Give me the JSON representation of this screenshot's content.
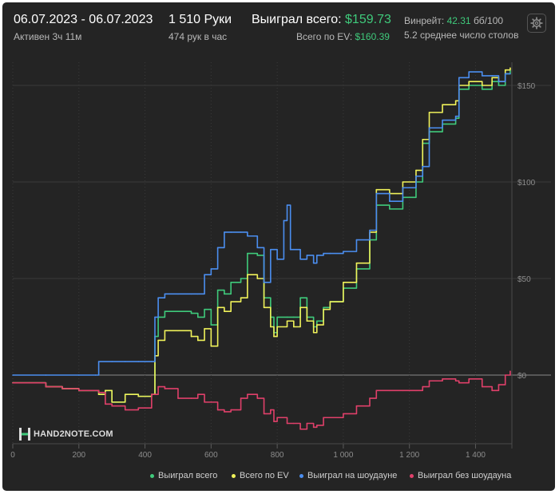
{
  "header": {
    "date_range": "06.07.2023 - 06.07.2023",
    "active_time": "Активен 3ч 11м",
    "hands": "1 510 Руки",
    "hands_per_hour": "474 рук в час",
    "won_total_label": "Выиграл всего:",
    "won_total_value": "$159.73",
    "ev_total_label": "Всего по EV:",
    "ev_total_value": "$160.39",
    "winrate_label": "Винрейт:",
    "winrate_value": "42.31",
    "winrate_unit": "бб/100",
    "avg_tables": "5.2 среднее число столов"
  },
  "logo": {
    "text": "HAND2NOTE.COM"
  },
  "icons": {
    "settings": "gear-icon",
    "logo": "h2n-logo-icon"
  },
  "colors": {
    "background": "#242424",
    "won_total": "#3fca7b",
    "ev_total": "#f0f25a",
    "showdown": "#4b8ef0",
    "non_showdown": "#e0406a",
    "grid": "#3a3a3a",
    "zero_line": "#8a8a8a"
  },
  "chart_data": {
    "type": "line",
    "xlim": [
      0,
      1510
    ],
    "ylim": [
      -30,
      160
    ],
    "x_ticks": [
      0,
      200,
      400,
      600,
      800,
      1000,
      1200,
      1400
    ],
    "x_tick_labels": [
      "0",
      "200",
      "400",
      "600",
      "800",
      "1 000",
      "1 200",
      "1 400"
    ],
    "y_ticks": [
      150,
      100,
      50,
      0
    ],
    "y_tick_labels": [
      "$150",
      "$100",
      "$50",
      "$0"
    ],
    "grid": true,
    "legend_position": "bottom-right",
    "series": [
      {
        "name": "Выиграл всего",
        "color": "#3fca7b",
        "points": [
          [
            0,
            -4
          ],
          [
            50,
            -4
          ],
          [
            100,
            -6
          ],
          [
            150,
            -7
          ],
          [
            200,
            -8
          ],
          [
            260,
            -10
          ],
          [
            280,
            -8
          ],
          [
            300,
            -14
          ],
          [
            340,
            -10
          ],
          [
            380,
            -11
          ],
          [
            420,
            -10
          ],
          [
            430,
            20
          ],
          [
            440,
            30
          ],
          [
            460,
            33
          ],
          [
            500,
            33
          ],
          [
            540,
            32
          ],
          [
            560,
            30
          ],
          [
            580,
            34
          ],
          [
            600,
            26
          ],
          [
            620,
            44
          ],
          [
            640,
            42
          ],
          [
            660,
            48
          ],
          [
            690,
            50
          ],
          [
            710,
            63
          ],
          [
            740,
            62
          ],
          [
            760,
            40
          ],
          [
            780,
            30
          ],
          [
            790,
            22
          ],
          [
            800,
            30
          ],
          [
            830,
            30
          ],
          [
            850,
            30
          ],
          [
            870,
            40
          ],
          [
            890,
            30
          ],
          [
            910,
            25
          ],
          [
            920,
            28
          ],
          [
            940,
            35
          ],
          [
            960,
            38
          ],
          [
            1000,
            45
          ],
          [
            1040,
            55
          ],
          [
            1080,
            70
          ],
          [
            1100,
            88
          ],
          [
            1140,
            86
          ],
          [
            1180,
            92
          ],
          [
            1220,
            100
          ],
          [
            1240,
            120
          ],
          [
            1260,
            126
          ],
          [
            1300,
            130
          ],
          [
            1340,
            133
          ],
          [
            1350,
            148
          ],
          [
            1380,
            150
          ],
          [
            1420,
            148
          ],
          [
            1450,
            152
          ],
          [
            1470,
            150
          ],
          [
            1490,
            156
          ],
          [
            1505,
            158
          ]
        ]
      },
      {
        "name": "Всего по EV",
        "color": "#f0f25a",
        "points": [
          [
            0,
            -4
          ],
          [
            50,
            -4
          ],
          [
            100,
            -6
          ],
          [
            150,
            -7
          ],
          [
            200,
            -8
          ],
          [
            260,
            -10
          ],
          [
            280,
            -8
          ],
          [
            300,
            -14
          ],
          [
            340,
            -10
          ],
          [
            380,
            -11
          ],
          [
            420,
            -10
          ],
          [
            430,
            10
          ],
          [
            440,
            18
          ],
          [
            460,
            23
          ],
          [
            500,
            23
          ],
          [
            540,
            20
          ],
          [
            560,
            18
          ],
          [
            580,
            24
          ],
          [
            600,
            15
          ],
          [
            620,
            35
          ],
          [
            640,
            33
          ],
          [
            660,
            38
          ],
          [
            690,
            40
          ],
          [
            710,
            52
          ],
          [
            740,
            50
          ],
          [
            760,
            35
          ],
          [
            780,
            25
          ],
          [
            790,
            20
          ],
          [
            800,
            25
          ],
          [
            830,
            28
          ],
          [
            850,
            25
          ],
          [
            870,
            35
          ],
          [
            890,
            28
          ],
          [
            910,
            22
          ],
          [
            920,
            26
          ],
          [
            940,
            34
          ],
          [
            960,
            38
          ],
          [
            1000,
            48
          ],
          [
            1040,
            58
          ],
          [
            1080,
            74
          ],
          [
            1100,
            96
          ],
          [
            1140,
            94
          ],
          [
            1180,
            100
          ],
          [
            1220,
            106
          ],
          [
            1240,
            122
          ],
          [
            1260,
            136
          ],
          [
            1300,
            140
          ],
          [
            1340,
            142
          ],
          [
            1350,
            150
          ],
          [
            1380,
            152
          ],
          [
            1420,
            150
          ],
          [
            1450,
            154
          ],
          [
            1470,
            152
          ],
          [
            1490,
            158
          ],
          [
            1505,
            159
          ]
        ]
      },
      {
        "name": "Выиграл на шоудауне",
        "color": "#4b8ef0",
        "points": [
          [
            0,
            0
          ],
          [
            100,
            0
          ],
          [
            200,
            0
          ],
          [
            250,
            0
          ],
          [
            260,
            7
          ],
          [
            300,
            7
          ],
          [
            340,
            7
          ],
          [
            380,
            7
          ],
          [
            420,
            7
          ],
          [
            430,
            30
          ],
          [
            440,
            40
          ],
          [
            460,
            42
          ],
          [
            500,
            42
          ],
          [
            540,
            42
          ],
          [
            560,
            42
          ],
          [
            580,
            52
          ],
          [
            600,
            55
          ],
          [
            620,
            66
          ],
          [
            640,
            74
          ],
          [
            660,
            74
          ],
          [
            690,
            74
          ],
          [
            710,
            72
          ],
          [
            740,
            66
          ],
          [
            760,
            48
          ],
          [
            780,
            65
          ],
          [
            790,
            65
          ],
          [
            800,
            60
          ],
          [
            820,
            80
          ],
          [
            830,
            88
          ],
          [
            840,
            65
          ],
          [
            850,
            65
          ],
          [
            870,
            60
          ],
          [
            890,
            62
          ],
          [
            910,
            58
          ],
          [
            920,
            62
          ],
          [
            940,
            63
          ],
          [
            960,
            63
          ],
          [
            1000,
            64
          ],
          [
            1040,
            70
          ],
          [
            1080,
            75
          ],
          [
            1100,
            94
          ],
          [
            1140,
            90
          ],
          [
            1180,
            97
          ],
          [
            1220,
            103
          ],
          [
            1240,
            108
          ],
          [
            1260,
            128
          ],
          [
            1300,
            132
          ],
          [
            1340,
            134
          ],
          [
            1350,
            154
          ],
          [
            1380,
            157
          ],
          [
            1420,
            155
          ],
          [
            1450,
            155
          ],
          [
            1470,
            152
          ],
          [
            1490,
            156
          ],
          [
            1505,
            156
          ]
        ]
      },
      {
        "name": "Выиграл без шоудауна",
        "color": "#e0406a",
        "points": [
          [
            0,
            -4
          ],
          [
            50,
            -4
          ],
          [
            100,
            -6
          ],
          [
            150,
            -7
          ],
          [
            200,
            -8
          ],
          [
            260,
            -9
          ],
          [
            280,
            -15
          ],
          [
            300,
            -16
          ],
          [
            340,
            -18
          ],
          [
            380,
            -17
          ],
          [
            420,
            -10
          ],
          [
            430,
            -10
          ],
          [
            440,
            -6
          ],
          [
            460,
            -7
          ],
          [
            500,
            -12
          ],
          [
            540,
            -12
          ],
          [
            560,
            -10
          ],
          [
            580,
            -14
          ],
          [
            600,
            -14
          ],
          [
            620,
            -18
          ],
          [
            640,
            -19
          ],
          [
            660,
            -18
          ],
          [
            690,
            -12
          ],
          [
            710,
            -10
          ],
          [
            740,
            -12
          ],
          [
            760,
            -20
          ],
          [
            780,
            -18
          ],
          [
            790,
            -24
          ],
          [
            800,
            -22
          ],
          [
            830,
            -25
          ],
          [
            850,
            -25
          ],
          [
            870,
            -28
          ],
          [
            890,
            -25
          ],
          [
            910,
            -27
          ],
          [
            920,
            -26
          ],
          [
            940,
            -22
          ],
          [
            960,
            -22
          ],
          [
            1000,
            -20
          ],
          [
            1040,
            -16
          ],
          [
            1080,
            -12
          ],
          [
            1100,
            -8
          ],
          [
            1140,
            -8
          ],
          [
            1180,
            -8
          ],
          [
            1220,
            -8
          ],
          [
            1240,
            -6
          ],
          [
            1260,
            -3
          ],
          [
            1300,
            -2
          ],
          [
            1340,
            -3
          ],
          [
            1350,
            -4
          ],
          [
            1380,
            -2
          ],
          [
            1420,
            -6
          ],
          [
            1450,
            -8
          ],
          [
            1470,
            -5
          ],
          [
            1490,
            0
          ],
          [
            1505,
            2
          ]
        ]
      }
    ]
  }
}
